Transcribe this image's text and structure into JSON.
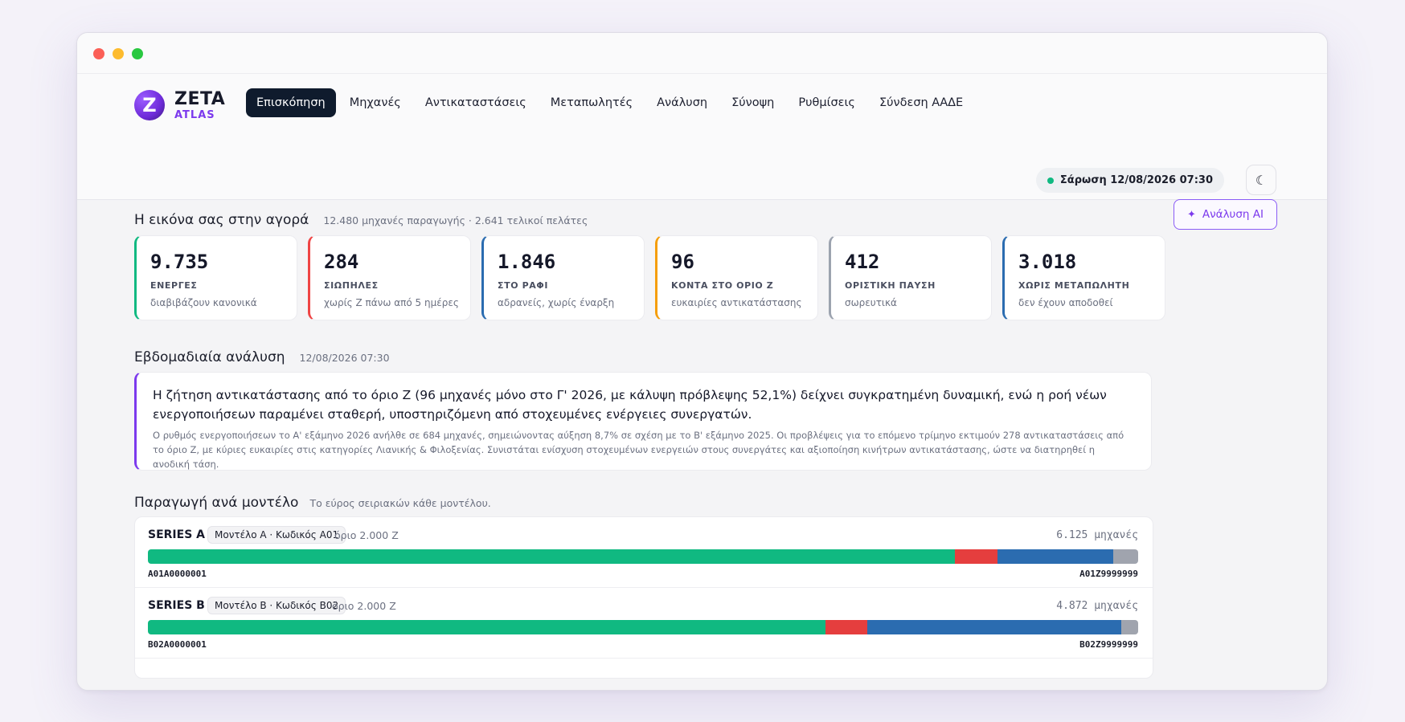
{
  "brand": {
    "mark": "Z",
    "name": "ZETA",
    "sub": "ATLAS"
  },
  "nav": [
    {
      "label": "Επισκόπηση",
      "active": true
    },
    {
      "label": "Μηχανές"
    },
    {
      "label": "Αντικαταστάσεις"
    },
    {
      "label": "Μεταπωλητές"
    },
    {
      "label": "Ανάλυση"
    },
    {
      "label": "Σύνοψη"
    },
    {
      "label": "Ρυθμίσεις"
    },
    {
      "label": "Σύνδεση ΑΑΔΕ"
    }
  ],
  "scan": {
    "label": "Σάρωση 12/08/2026 07:30"
  },
  "theme_icon": "moon-icon",
  "market": {
    "title": "Η εικόνα σας στην αγορά",
    "meta": "12.480 μηχανές παραγωγής · 2.641 τελικοί πελάτες",
    "ai_button": "Ανάλυση AI"
  },
  "cards": [
    {
      "value": "9.735",
      "label": "ΕΝΕΡΓΕΣ",
      "sub": "διαβιβάζουν κανονικά",
      "color": "#10b981"
    },
    {
      "value": "284",
      "label": "ΣΙΩΠΗΛΕΣ",
      "sub": "χωρίς Ζ πάνω από 5 ημέρες",
      "color": "#ef4444"
    },
    {
      "value": "1.846",
      "label": "ΣΤΟ ΡΑΦΙ",
      "sub": "αδρανείς, χωρίς έναρξη",
      "color": "#2b6cb0"
    },
    {
      "value": "96",
      "label": "ΚΟΝΤΑ ΣΤΟ ΟΡΙΟ Ζ",
      "sub": "ευκαιρίες αντικατάστασης",
      "color": "#f59e0b"
    },
    {
      "value": "412",
      "label": "ΟΡΙΣΤΙΚΗ ΠΑΥΣΗ",
      "sub": "σωρευτικά",
      "color": "#9ca3af"
    },
    {
      "value": "3.018",
      "label": "ΧΩΡΙΣ ΜΕΤΑΠΩΛΗΤΗ",
      "sub": "δεν έχουν αποδοθεί",
      "color": "#2b6cb0"
    }
  ],
  "weekly": {
    "title": "Εβδομαδιαία ανάλυση",
    "timestamp": "12/08/2026 07:30",
    "headline": "Η ζήτηση αντικατάστασης από το όριο Ζ (96 μηχανές μόνο στο Γ' 2026, με κάλυψη πρόβλεψης 52,1%) δείχνει συγκρατημένη δυναμική, ενώ η ροή νέων ενεργοποιήσεων παραμένει σταθερή, υποστηριζόμενη από στοχευμένες ενέργειες συνεργατών.",
    "detail": "Ο ρυθμός ενεργοποιήσεων το Α' εξάμηνο 2026 ανήλθε σε 684 μηχανές, σημειώνοντας αύξηση 8,7% σε σχέση με το Β' εξάμηνο 2025. Οι προβλέψεις για το επόμενο τρίμηνο εκτιμούν 278 αντικαταστάσεις από το όριο Ζ, με κύριες ευκαιρίες στις κατηγορίες Λιανικής & Φιλοξενίας. Συνιστάται ενίσχυση στοχευμένων ενεργειών στους συνεργάτες και αξιοποίηση κινήτρων αντικατάστασης, ώστε να διατηρηθεί η ανοδική τάση."
  },
  "production": {
    "title": "Παραγωγή ανά μοντέλο",
    "meta": "Το εύρος σειριακών κάθε μοντέλου.",
    "segment_colors": [
      "#10b981",
      "#e53e3e",
      "#2b6cb0",
      "#a0a4ae"
    ],
    "models": [
      {
        "name": "SERIES A",
        "tag": "Μοντέλο Α · Κωδικός Α01",
        "limit": "όριο 2.000 Ζ",
        "count": "6.125 μηχανές",
        "serial_start": "A01A0000001",
        "serial_end": "A01Z9999999",
        "segments": [
          0.815,
          0.043,
          0.117,
          0.025
        ]
      },
      {
        "name": "SERIES B",
        "tag": "Μοντέλο Β · Κωδικός Β02",
        "limit": "όριο 2.000 Ζ",
        "count": "4.872 μηχανές",
        "serial_start": "B02A0000001",
        "serial_end": "B02Z9999999",
        "segments": [
          0.686,
          0.043,
          0.257,
          0.017
        ]
      }
    ]
  }
}
